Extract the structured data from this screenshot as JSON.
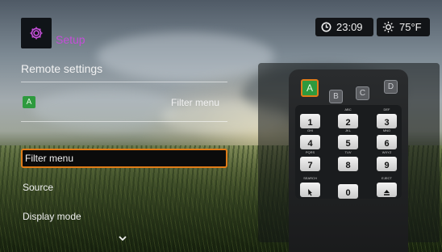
{
  "header": {
    "title": "Setup",
    "clock": "23:09",
    "temperature": "75°F",
    "icons": {
      "logo": "gear-icon",
      "clock": "clock-icon",
      "weather": "sun-icon"
    }
  },
  "section": {
    "title": "Remote settings",
    "assigned_button": "A",
    "assigned_function": "Filter menu"
  },
  "menu": {
    "items": [
      {
        "label": "Filter menu",
        "selected": true
      },
      {
        "label": "Source",
        "selected": false
      },
      {
        "label": "Display mode",
        "selected": false
      }
    ],
    "more_icon": "chevron-down-icon"
  },
  "remote": {
    "color_keys": [
      "A",
      "B",
      "C",
      "D"
    ],
    "selected_key": "A",
    "keys": [
      {
        "main": "1",
        "sub": ""
      },
      {
        "main": "2",
        "sub": "ABC"
      },
      {
        "main": "3",
        "sub": "DEF"
      },
      {
        "main": "4",
        "sub": "GHI"
      },
      {
        "main": "5",
        "sub": "JKL"
      },
      {
        "main": "6",
        "sub": "MNO"
      },
      {
        "main": "7",
        "sub": "PQRS"
      },
      {
        "main": "8",
        "sub": "TUV"
      },
      {
        "main": "9",
        "sub": "WXYZ"
      },
      {
        "main": "",
        "sub": "SEARCH",
        "icon": "search-key-icon"
      },
      {
        "main": "0",
        "sub": ""
      },
      {
        "main": "",
        "sub": "EJECT",
        "icon": "eject-icon"
      }
    ]
  },
  "colors": {
    "accent_orange": "#e07c18",
    "title_purple": "#c44fd8",
    "key_green": "#2e9a3e"
  }
}
